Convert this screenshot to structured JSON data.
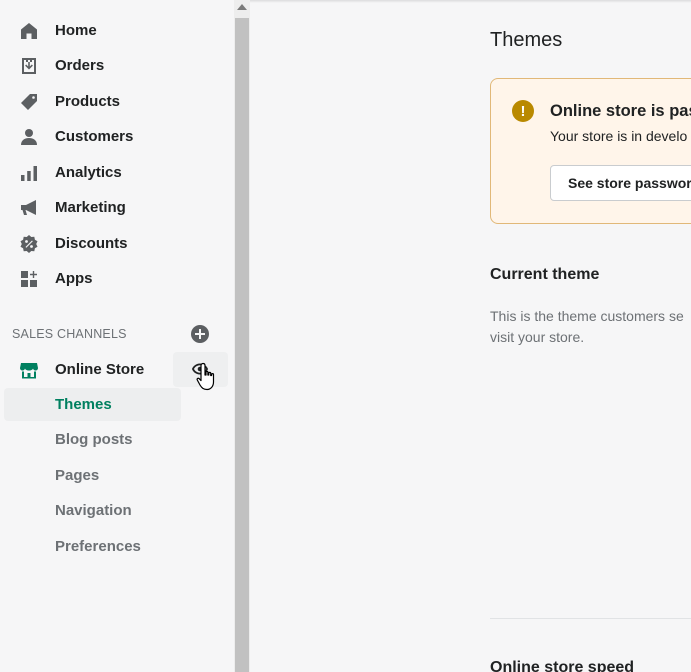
{
  "sidebar": {
    "items": [
      {
        "label": "Home",
        "icon": "home-icon"
      },
      {
        "label": "Orders",
        "icon": "orders-icon"
      },
      {
        "label": "Products",
        "icon": "tag-icon"
      },
      {
        "label": "Customers",
        "icon": "person-icon"
      },
      {
        "label": "Analytics",
        "icon": "bar-chart-icon"
      },
      {
        "label": "Marketing",
        "icon": "megaphone-icon"
      },
      {
        "label": "Discounts",
        "icon": "discount-icon"
      },
      {
        "label": "Apps",
        "icon": "apps-icon"
      }
    ],
    "sales_channels": {
      "heading": "SALES CHANNELS",
      "online_store": {
        "label": "Online Store",
        "icon": "store-icon"
      },
      "sub_items": [
        "Themes",
        "Blog posts",
        "Pages",
        "Navigation",
        "Preferences"
      ],
      "active_sub_item": "Themes"
    }
  },
  "main": {
    "title": "Themes",
    "banner": {
      "title": "Online store is pas",
      "text": "Your store is in develo",
      "button_label": "See store passwor"
    },
    "current_theme": {
      "title": "Current theme",
      "description_line1": "This is the theme customers se",
      "description_line2": "visit your store."
    },
    "next_section_title": "Online store speed"
  },
  "colors": {
    "accent": "#008060",
    "warning_icon": "#b98900",
    "banner_bg": "#fff5ea",
    "banner_border": "#e1b878",
    "active_bg": "#edeeef"
  }
}
